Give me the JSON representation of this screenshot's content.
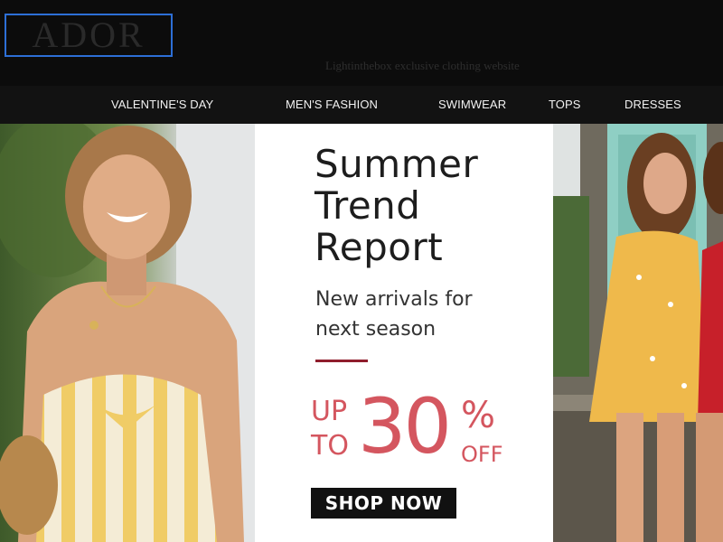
{
  "header": {
    "logo": "ADOR",
    "tagline": "Lightinthebox exclusive clothing website"
  },
  "nav": {
    "items": [
      {
        "label": "VALENTINE'S DAY"
      },
      {
        "label": "MEN'S FASHION"
      },
      {
        "label": "SWIMWEAR"
      },
      {
        "label": "TOPS"
      },
      {
        "label": "DRESSES"
      }
    ]
  },
  "banner": {
    "title_lines": [
      "Summer",
      "Trend",
      "Report"
    ],
    "subtitle_lines": [
      "New arrivals for",
      "next season"
    ],
    "sale": {
      "up": "UP",
      "to": "TO",
      "number": "30",
      "percent": "%",
      "off": "OFF"
    },
    "cta_label": "SHOP NOW"
  },
  "colors": {
    "page_background": "#0c0c0c",
    "nav_background": "#121212",
    "logo_border": "#2d6fd6",
    "sale_red": "#d4565f",
    "accent_rule": "#8f1d2c",
    "cta_background": "#111111"
  }
}
